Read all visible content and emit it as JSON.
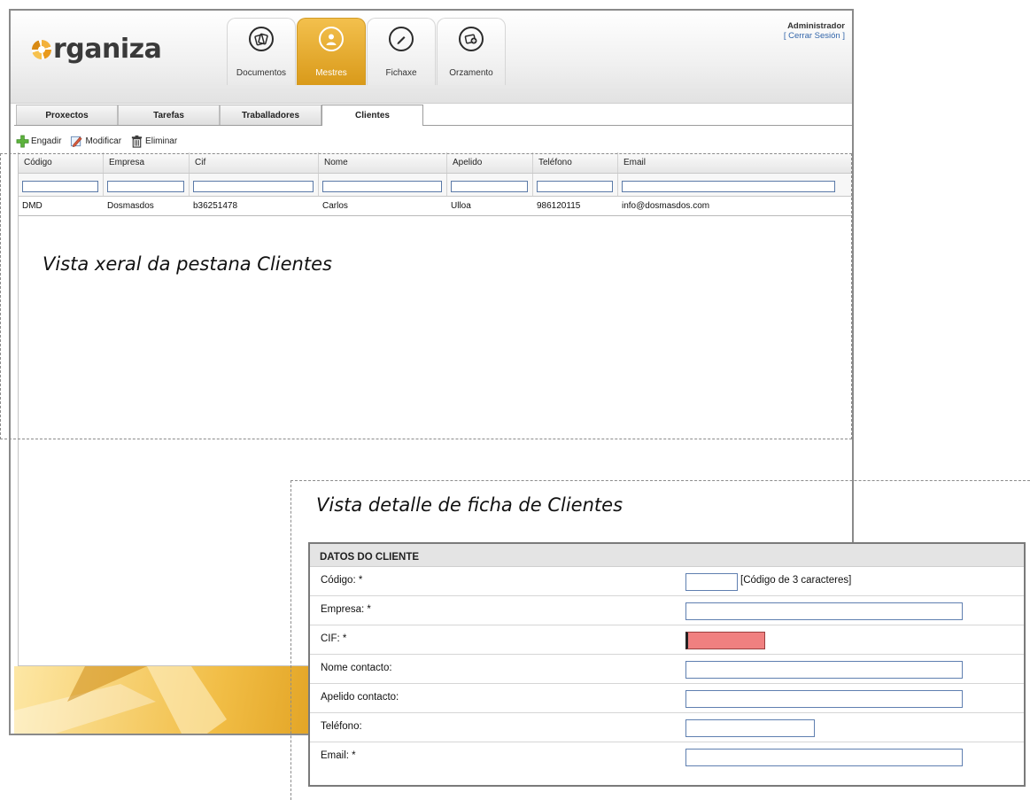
{
  "app": {
    "logo_text": "rganiza",
    "nav_tabs": [
      {
        "label": "Documentos",
        "icon": "documents-icon"
      },
      {
        "label": "Mestres",
        "icon": "user-icon"
      },
      {
        "label": "Fichaxe",
        "icon": "pencil-icon"
      },
      {
        "label": "Orzamento",
        "icon": "budget-icon"
      }
    ],
    "user": {
      "name": "Administrador",
      "logout": "[ Cerrar Sesión ]"
    },
    "subtabs": [
      "Proxectos",
      "Tarefas",
      "Traballadores",
      "Clientes"
    ],
    "active_subtab": "Clientes",
    "toolbar": {
      "add": "Engadir",
      "edit": "Modificar",
      "delete": "Eliminar"
    },
    "grid": {
      "columns": [
        "Código",
        "Empresa",
        "Cif",
        "Nome",
        "Apelido",
        "Teléfono",
        "Email"
      ],
      "rows": [
        [
          "DMD",
          "Dosmasdos",
          "b36251478",
          "Carlos",
          "Ulloa",
          "986120115",
          "info@dosmasdos.com"
        ]
      ]
    }
  },
  "captions": {
    "list_view": "Vista xeral da pestana Clientes",
    "detail_view": "Vista detalle de ficha de Clientes"
  },
  "detail_form": {
    "title": "DATOS DO CLIENTE",
    "fields": [
      {
        "label": "Código: *",
        "hint": "[Código de 3 caracteres]"
      },
      {
        "label": "Empresa: *"
      },
      {
        "label": "CIF: *",
        "state": "invalid"
      },
      {
        "label": "Nome contacto:"
      },
      {
        "label": "Apelido contacto:"
      },
      {
        "label": "Teléfono:"
      },
      {
        "label": "Email: *"
      }
    ]
  },
  "colors": {
    "accent": "#e3a32a",
    "invalid_field": "#f08080",
    "input_border": "#5f7fb0"
  }
}
